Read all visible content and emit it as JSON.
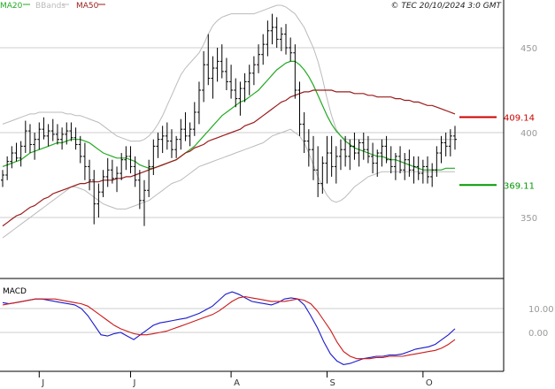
{
  "chart_data": [
    {
      "type": "line",
      "panel": "price",
      "legend": [
        {
          "name": "MA20",
          "color": "#22aa22"
        },
        {
          "name": "BBands",
          "color": "#bbbbbb"
        },
        {
          "name": "MA50",
          "color": "#9b1b1b"
        }
      ],
      "copyright": "© TEC 20/10/2024 3:0 GMT",
      "ylim": [
        315,
        475
      ],
      "y_ticks": [
        {
          "value": 450,
          "label": "450"
        },
        {
          "value": 400,
          "label": "400"
        },
        {
          "value": 350,
          "label": "350"
        }
      ],
      "x_ticks": [
        "J",
        "J",
        "A",
        "S",
        "O"
      ],
      "markers": [
        {
          "value": 409.14,
          "label": "409.14",
          "color": "#cc0000"
        },
        {
          "value": 369.11,
          "label": "369.11",
          "color": "#009900"
        }
      ],
      "ohlc": [
        [
          372,
          378,
          368,
          375
        ],
        [
          375,
          386,
          372,
          383
        ],
        [
          383,
          392,
          379,
          388
        ],
        [
          388,
          394,
          383,
          385
        ],
        [
          385,
          395,
          380,
          392
        ],
        [
          392,
          407,
          388,
          401
        ],
        [
          401,
          405,
          388,
          393
        ],
        [
          393,
          400,
          384,
          396
        ],
        [
          396,
          406,
          390,
          402
        ],
        [
          402,
          409,
          396,
          398
        ],
        [
          398,
          405,
          392,
          401
        ],
        [
          401,
          408,
          395,
          399
        ],
        [
          399,
          405,
          393,
          396
        ],
        [
          396,
          403,
          390,
          399
        ],
        [
          399,
          406,
          393,
          401
        ],
        [
          401,
          406,
          395,
          397
        ],
        [
          397,
          403,
          390,
          393
        ],
        [
          393,
          398,
          382,
          386
        ],
        [
          386,
          394,
          372,
          380
        ],
        [
          380,
          384,
          366,
          372
        ],
        [
          372,
          378,
          346,
          358
        ],
        [
          358,
          370,
          350,
          365
        ],
        [
          365,
          378,
          362,
          374
        ],
        [
          374,
          385,
          368,
          378
        ],
        [
          378,
          384,
          370,
          373
        ],
        [
          373,
          380,
          365,
          376
        ],
        [
          376,
          388,
          372,
          384
        ],
        [
          384,
          392,
          378,
          386
        ],
        [
          386,
          392,
          376,
          380
        ],
        [
          380,
          386,
          368,
          372
        ],
        [
          372,
          378,
          355,
          360
        ],
        [
          360,
          372,
          345,
          366
        ],
        [
          366,
          384,
          362,
          380
        ],
        [
          380,
          396,
          375,
          392
        ],
        [
          392,
          400,
          385,
          396
        ],
        [
          396,
          404,
          388,
          398
        ],
        [
          398,
          406,
          390,
          395
        ],
        [
          395,
          402,
          385,
          390
        ],
        [
          390,
          398,
          385,
          396
        ],
        [
          396,
          408,
          390,
          402
        ],
        [
          402,
          412,
          395,
          398
        ],
        [
          398,
          406,
          392,
          402
        ],
        [
          402,
          418,
          398,
          412
        ],
        [
          412,
          430,
          405,
          425
        ],
        [
          425,
          448,
          418,
          440
        ],
        [
          440,
          458,
          428,
          432
        ],
        [
          432,
          445,
          420,
          438
        ],
        [
          438,
          450,
          430,
          442
        ],
        [
          442,
          452,
          432,
          436
        ],
        [
          436,
          444,
          425,
          430
        ],
        [
          430,
          440,
          420,
          425
        ],
        [
          425,
          432,
          415,
          420
        ],
        [
          420,
          430,
          410,
          426
        ],
        [
          426,
          435,
          418,
          430
        ],
        [
          430,
          440,
          422,
          435
        ],
        [
          435,
          445,
          428,
          440
        ],
        [
          440,
          452,
          435,
          446
        ],
        [
          446,
          458,
          440,
          452
        ],
        [
          452,
          466,
          445,
          460
        ],
        [
          460,
          470,
          452,
          462
        ],
        [
          462,
          468,
          450,
          455
        ],
        [
          455,
          462,
          448,
          458
        ],
        [
          458,
          464,
          446,
          450
        ],
        [
          450,
          456,
          442,
          447
        ],
        [
          447,
          452,
          420,
          425
        ],
        [
          425,
          430,
          398,
          405
        ],
        [
          405,
          412,
          388,
          395
        ],
        [
          395,
          402,
          380,
          390
        ],
        [
          390,
          398,
          372,
          378
        ],
        [
          378,
          392,
          362,
          370
        ],
        [
          370,
          386,
          364,
          382
        ],
        [
          382,
          398,
          370,
          388
        ],
        [
          388,
          398,
          374,
          380
        ],
        [
          380,
          392,
          370,
          386
        ],
        [
          386,
          396,
          378,
          390
        ],
        [
          390,
          398,
          380,
          386
        ],
        [
          386,
          396,
          378,
          392
        ],
        [
          392,
          400,
          384,
          388
        ],
        [
          388,
          396,
          380,
          394
        ],
        [
          394,
          400,
          384,
          390
        ],
        [
          390,
          398,
          382,
          386
        ],
        [
          386,
          394,
          376,
          382
        ],
        [
          382,
          390,
          374,
          388
        ],
        [
          388,
          396,
          380,
          392
        ],
        [
          392,
          398,
          382,
          384
        ],
        [
          384,
          392,
          376,
          380
        ],
        [
          380,
          388,
          372,
          386
        ],
        [
          386,
          392,
          376,
          378
        ],
        [
          378,
          388,
          372,
          384
        ],
        [
          384,
          390,
          374,
          378
        ],
        [
          378,
          386,
          370,
          380
        ],
        [
          380,
          386,
          372,
          376
        ],
        [
          376,
          384,
          370,
          380
        ],
        [
          380,
          386,
          370,
          374
        ],
        [
          374,
          382,
          368,
          378
        ],
        [
          378,
          392,
          374,
          388
        ],
        [
          388,
          398,
          382,
          394
        ],
        [
          394,
          400,
          386,
          392
        ],
        [
          392,
          402,
          386,
          398
        ],
        [
          398,
          404,
          390,
          396
        ]
      ],
      "x_tick_index": [
        8,
        28,
        50,
        71,
        92
      ],
      "series": [
        {
          "name": "MA20",
          "color": "#22aa22",
          "values": [
            380,
            381,
            382,
            383,
            384,
            386,
            388,
            389,
            390,
            391,
            392,
            393,
            394,
            394,
            395,
            396,
            396,
            396,
            395,
            394,
            392,
            390,
            388,
            387,
            386,
            385,
            385,
            385,
            384,
            383,
            381,
            380,
            379,
            379,
            380,
            381,
            382,
            383,
            384,
            386,
            388,
            390,
            392,
            395,
            398,
            401,
            404,
            407,
            410,
            412,
            414,
            416,
            418,
            419,
            421,
            423,
            425,
            428,
            431,
            434,
            437,
            439,
            441,
            442,
            442,
            440,
            437,
            433,
            428,
            422,
            416,
            410,
            405,
            401,
            398,
            395,
            393,
            391,
            390,
            389,
            388,
            387,
            386,
            386,
            385,
            384,
            384,
            383,
            382,
            381,
            380,
            379,
            378,
            378,
            378,
            378,
            378,
            379,
            379,
            379
          ]
        },
        {
          "name": "MA50",
          "color": "#9b1b1b",
          "values": [
            345,
            347,
            349,
            351,
            352,
            354,
            356,
            357,
            359,
            361,
            362,
            364,
            365,
            366,
            367,
            368,
            369,
            370,
            370,
            371,
            371,
            371,
            372,
            372,
            372,
            373,
            373,
            374,
            374,
            375,
            376,
            377,
            378,
            379,
            380,
            381,
            382,
            383,
            384,
            386,
            388,
            389,
            391,
            392,
            393,
            395,
            396,
            397,
            398,
            399,
            400,
            401,
            402,
            404,
            405,
            406,
            408,
            410,
            412,
            414,
            416,
            418,
            419,
            421,
            422,
            423,
            424,
            424,
            425,
            425,
            425,
            425,
            425,
            424,
            424,
            424,
            424,
            423,
            423,
            423,
            422,
            422,
            421,
            421,
            421,
            421,
            420,
            420,
            419,
            419,
            418,
            418,
            417,
            416,
            416,
            415,
            414,
            413,
            412,
            411
          ]
        },
        {
          "name": "BBands",
          "color": "#bbbbbb",
          "values": [
            405,
            406,
            407,
            408,
            409,
            410,
            411,
            411,
            412,
            412,
            412,
            412,
            412,
            412,
            411,
            411,
            410,
            410,
            409,
            408,
            407,
            406,
            404,
            402,
            400,
            398,
            397,
            396,
            395,
            395,
            395,
            396,
            398,
            401,
            405,
            410,
            416,
            422,
            428,
            434,
            438,
            441,
            444,
            447,
            452,
            458,
            463,
            466,
            468,
            469,
            470,
            470,
            470,
            470,
            470,
            470,
            471,
            472,
            473,
            474,
            475,
            475,
            474,
            472,
            470,
            466,
            462,
            456,
            450,
            442,
            432,
            420,
            410,
            402,
            398,
            396,
            396,
            396,
            396,
            396,
            396,
            396,
            396,
            396,
            396,
            396,
            396,
            396,
            396,
            396,
            396,
            396,
            396,
            396,
            396,
            396,
            396,
            396,
            396,
            396
          ]
        },
        {
          "name": "BBands-lower",
          "color": "#bbbbbb",
          "values": [
            338,
            340,
            342,
            344,
            346,
            348,
            350,
            352,
            354,
            356,
            358,
            360,
            362,
            364,
            366,
            368,
            368,
            367,
            366,
            364,
            362,
            360,
            358,
            357,
            356,
            355,
            355,
            355,
            356,
            357,
            358,
            359,
            360,
            362,
            364,
            366,
            368,
            370,
            371,
            372,
            374,
            376,
            378,
            380,
            381,
            382,
            383,
            384,
            385,
            386,
            387,
            388,
            389,
            390,
            391,
            392,
            393,
            394,
            396,
            398,
            399,
            400,
            401,
            402,
            400,
            398,
            394,
            388,
            381,
            374,
            368,
            363,
            360,
            359,
            360,
            362,
            365,
            368,
            370,
            372,
            374,
            375,
            376,
            377,
            377,
            377,
            377,
            377,
            377,
            377,
            377,
            377,
            377,
            377,
            377,
            377,
            377,
            377,
            377,
            377
          ]
        }
      ]
    },
    {
      "type": "line",
      "panel": "macd",
      "title": "MACD",
      "y_ticks": [
        {
          "value": 10,
          "label": "10.00"
        },
        {
          "value": 0,
          "label": "0.00"
        }
      ],
      "ylim": [
        -16,
        22
      ],
      "series": [
        {
          "name": "MACD",
          "color": "#1a1acc",
          "values": [
            12.5,
            12,
            12.5,
            13,
            13.5,
            14,
            14,
            13.5,
            13,
            12.5,
            12,
            11.5,
            10,
            7,
            3,
            -1,
            -1.5,
            -0.5,
            0,
            -1.5,
            -3,
            -1,
            1,
            3,
            4,
            4.5,
            5,
            5.5,
            6,
            7,
            8,
            9.5,
            11,
            13.5,
            16,
            17,
            16,
            14.5,
            13,
            12.5,
            12,
            11.5,
            12.5,
            14,
            14.5,
            14,
            11.5,
            7,
            2,
            -4,
            -9,
            -12,
            -13.5,
            -13,
            -12,
            -11,
            -10.5,
            -10,
            -10,
            -9.5,
            -9.5,
            -9,
            -8,
            -7,
            -6.5,
            -6,
            -5,
            -3,
            -1,
            1.5
          ]
        },
        {
          "name": "Signal",
          "color": "#cc1a1a",
          "values": [
            11.5,
            12,
            12.5,
            13,
            13.5,
            14,
            14,
            14,
            14,
            13.5,
            13,
            12.5,
            12,
            11,
            9,
            7,
            5,
            3,
            1.5,
            0.5,
            -0.5,
            -1,
            -1,
            -0.5,
            0,
            0.5,
            1.5,
            2.5,
            3.5,
            4.5,
            5.5,
            6.5,
            7.5,
            9,
            11,
            13,
            14.5,
            15,
            14.5,
            14,
            13.5,
            13,
            13,
            13,
            13.5,
            14,
            13.5,
            12,
            9,
            5,
            1,
            -4,
            -8,
            -10,
            -11,
            -11,
            -11,
            -10.5,
            -10.5,
            -10,
            -10,
            -10,
            -9.5,
            -9,
            -8.5,
            -8,
            -7.5,
            -6.5,
            -5,
            -3
          ]
        }
      ]
    }
  ]
}
